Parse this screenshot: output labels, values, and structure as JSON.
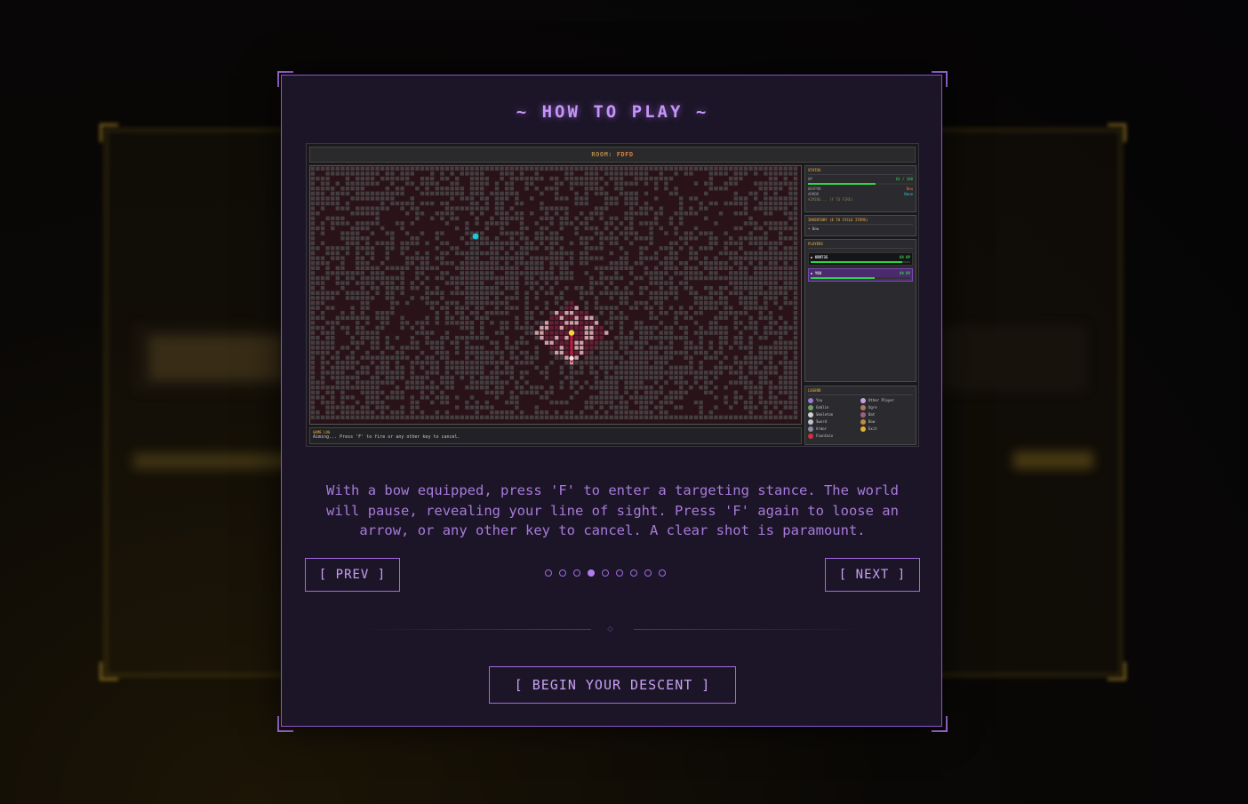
{
  "modal": {
    "title": "~ HOW TO PLAY ~",
    "description": "With a bow equipped, press 'F' to enter a targeting stance. The world will pause, revealing your line of sight. Press 'F' again to loose an arrow, or any other key to cancel. A clear shot is paramount.",
    "prev_label": "[ PREV ]",
    "next_label": "[ NEXT ]",
    "begin_label": "[ BEGIN YOUR DESCENT ]",
    "pagination": {
      "total": 9,
      "current": 4
    },
    "divider_glyph": "◇"
  },
  "screenshot": {
    "room_label": "ROOM:",
    "room_id": "FDFD",
    "status": {
      "title": "STATUS",
      "hp_label": "HP",
      "hp_value": "64 / 100",
      "hp_fraction": 0.64,
      "weapon_label": "WEAPON",
      "weapon_value": "Bow",
      "armor_label": "ARMOR",
      "armor_value": "None",
      "aiming_text": "AIMING... (F TO FIRE)"
    },
    "inventory": {
      "title": "INVENTORY (E TO CYCLE ITEMS)",
      "items": [
        "• Bow"
      ]
    },
    "players": {
      "title": "PLAYERS",
      "list": [
        {
          "name": "▶ KRRT35",
          "hp": "64 HP",
          "fraction": 0.92
        },
        {
          "name": "▶ YOU",
          "hp": "64 HP",
          "fraction": 0.64
        }
      ]
    },
    "legend": {
      "title": "LEGEND",
      "items": [
        {
          "label": "You",
          "color": "#9a7bd0"
        },
        {
          "label": "Other Player",
          "color": "#c9a0e0"
        },
        {
          "label": "Goblin",
          "color": "#6fa060"
        },
        {
          "label": "Ogre",
          "color": "#b07a5a"
        },
        {
          "label": "Skeleton",
          "color": "#d0d0d0"
        },
        {
          "label": "Bat",
          "color": "#a06080"
        },
        {
          "label": "Sword",
          "color": "#c0c0d0"
        },
        {
          "label": "Bow",
          "color": "#c08a40"
        },
        {
          "label": "Armor",
          "color": "#8a8aa0"
        },
        {
          "label": "Exit",
          "color": "#e0b030"
        },
        {
          "label": "Fountain",
          "color": "#d03040"
        }
      ]
    },
    "game_log": {
      "title": "GAME LOG",
      "message": "Aiming... Press 'F' to fire or any other key to cancel."
    },
    "colors": {
      "floor": "#2a1219",
      "wall": "#4a4a4a",
      "lit_floor": "#6b2038",
      "lit_wall": "#e8b8c0",
      "aim_line": "#d0183a",
      "fountain": "#1ec8d8",
      "player": "#f2d640"
    }
  },
  "colors": {
    "accent": "#a06be0",
    "title": "#c595f7",
    "text": "#a77ad9",
    "modal_bg": "#1c1528"
  }
}
